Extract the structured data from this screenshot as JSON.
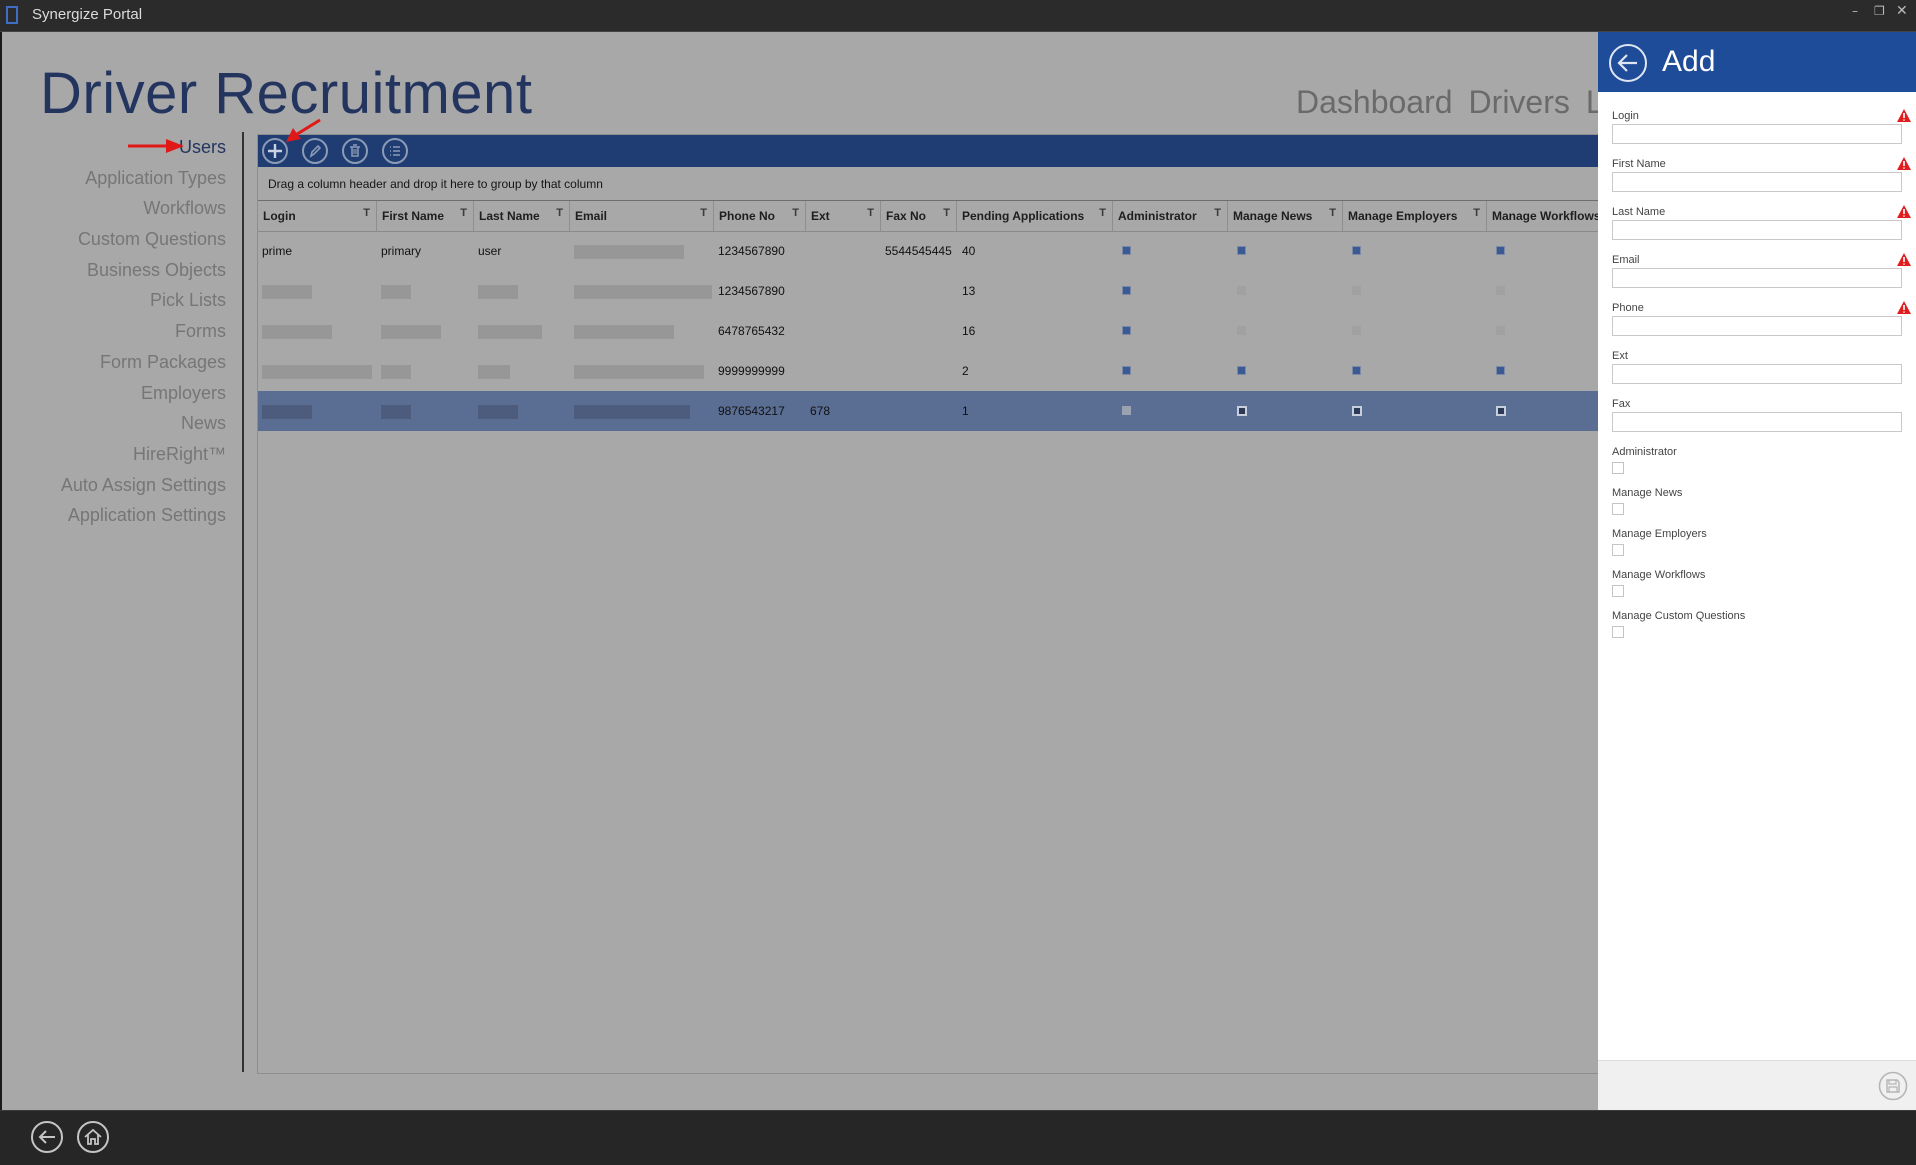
{
  "window": {
    "title": "Synergize Portal"
  },
  "app": {
    "title": "Driver Recruitment"
  },
  "topnav": [
    "Dashboard",
    "Drivers",
    "Lea"
  ],
  "sidebar": {
    "items": [
      {
        "label": "Users",
        "active": true
      },
      {
        "label": "Application Types"
      },
      {
        "label": "Workflows"
      },
      {
        "label": "Custom Questions"
      },
      {
        "label": "Business Objects"
      },
      {
        "label": "Pick Lists"
      },
      {
        "label": "Forms"
      },
      {
        "label": "Form Packages"
      },
      {
        "label": "Employers"
      },
      {
        "label": "News"
      },
      {
        "label": "HireRight™"
      },
      {
        "label": "Auto Assign Settings"
      },
      {
        "label": "Application Settings"
      }
    ]
  },
  "grid": {
    "toolbar_icons": [
      "add-icon",
      "edit-icon",
      "delete-icon",
      "list-icon"
    ],
    "group_hint": "Drag a column header and drop it here to group by that column",
    "columns": [
      "Login",
      "First Name",
      "Last Name",
      "Email",
      "Phone No",
      "Ext",
      "Fax No",
      "Pending Applications",
      "Administrator",
      "Manage News",
      "Manage Employers",
      "Manage Workflows"
    ],
    "filter_glyph": "T",
    "rows": [
      {
        "login": "prime",
        "first_name": "primary",
        "last_name": "user",
        "email": "",
        "phone": "1234567890",
        "ext": "",
        "fax": "5544545445",
        "pending": "40",
        "admin": true,
        "news": true,
        "employers": true,
        "workflows": true,
        "selected": false
      },
      {
        "login": "",
        "first_name": "",
        "last_name": "",
        "email": "",
        "phone": "1234567890",
        "ext": "",
        "fax": "",
        "pending": "13",
        "admin": true,
        "news": false,
        "employers": false,
        "workflows": false,
        "selected": false
      },
      {
        "login": "",
        "first_name": "",
        "last_name": "",
        "email": "",
        "phone": "6478765432",
        "ext": "",
        "fax": "",
        "pending": "16",
        "admin": true,
        "news": false,
        "employers": false,
        "workflows": false,
        "selected": false
      },
      {
        "login": "",
        "first_name": "",
        "last_name": "",
        "email": "",
        "phone": "9999999999",
        "ext": "",
        "fax": "",
        "pending": "2",
        "admin": true,
        "news": true,
        "employers": true,
        "workflows": true,
        "selected": false
      },
      {
        "login": "",
        "first_name": "",
        "last_name": "",
        "email": "",
        "phone": "9876543217",
        "ext": "678",
        "fax": "",
        "pending": "1",
        "admin": false,
        "news": true,
        "employers": true,
        "workflows": true,
        "selected": true
      }
    ]
  },
  "flyout": {
    "title": "Add",
    "fields": [
      {
        "label": "Login",
        "value": "",
        "required": true
      },
      {
        "label": "First Name",
        "value": "",
        "required": true
      },
      {
        "label": "Last Name",
        "value": "",
        "required": true
      },
      {
        "label": "Email",
        "value": "",
        "required": true
      },
      {
        "label": "Phone",
        "value": "",
        "required": true
      },
      {
        "label": "Ext",
        "value": "",
        "required": false
      },
      {
        "label": "Fax",
        "value": "",
        "required": false
      }
    ],
    "checkboxes": [
      {
        "label": "Administrator",
        "checked": false
      },
      {
        "label": "Manage News",
        "checked": false
      },
      {
        "label": "Manage Employers",
        "checked": false
      },
      {
        "label": "Manage Workflows",
        "checked": false
      },
      {
        "label": "Manage Custom Questions",
        "checked": false
      }
    ],
    "save_icon": "save-icon"
  },
  "colors": {
    "accent": "#1f4c98",
    "toolbar": "#1f3d72",
    "title_text": "#23355f",
    "selected_row": "#5a6d92",
    "warning": "#e02020",
    "annotation": "#e01818"
  }
}
